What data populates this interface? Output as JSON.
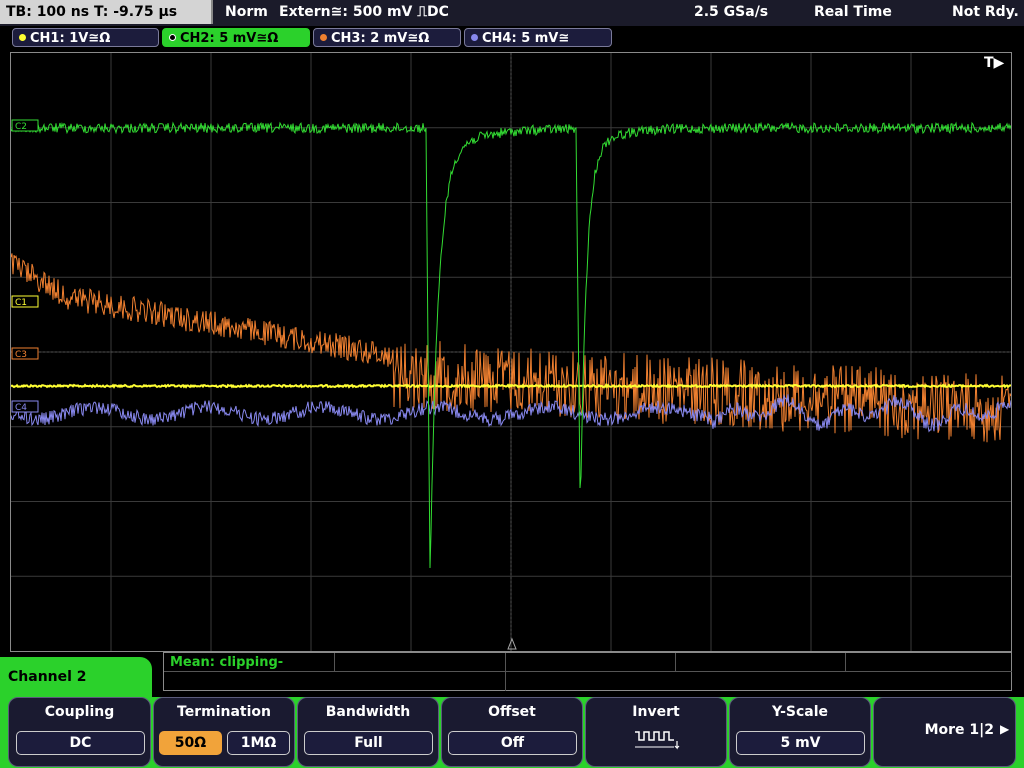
{
  "status": {
    "timebase": "TB: 100 ns   T: -9.75 µs",
    "mode": "Norm",
    "trigger": "Extern≅: 500 mV ⎍DC",
    "sample_rate": "2.5 GSa/s",
    "acq_mode": "Real Time",
    "state": "Not Rdy."
  },
  "channels": [
    {
      "label": "CH1: 1V≅Ω",
      "color": "#ffff33"
    },
    {
      "label": "CH2: 5 mV≅Ω",
      "color": "#33dd33",
      "active": true
    },
    {
      "label": "CH3: 2 mV≅Ω",
      "color": "#f08030"
    },
    {
      "label": "CH4: 5 mV≅",
      "color": "#8888ee"
    }
  ],
  "trigger_marker": "T▶",
  "markers": {
    "c1": "C1",
    "c3": "C3",
    "c4": "C4",
    "c2": "C2"
  },
  "measurement": {
    "mean": "Mean: clipping-"
  },
  "menu": {
    "title": "Channel 2",
    "coupling": {
      "title": "Coupling",
      "value": "DC"
    },
    "termination": {
      "title": "Termination",
      "opt1": "50Ω",
      "opt2": "1MΩ",
      "selected": "50Ω"
    },
    "bandwidth": {
      "title": "Bandwidth",
      "value": "Full"
    },
    "offset": {
      "title": "Offset",
      "value": "Off"
    },
    "invert": {
      "title": "Invert",
      "icon": "invert-waveform-icon"
    },
    "yscale": {
      "title": "Y-Scale",
      "value": "5 mV"
    },
    "more": {
      "label": "More 1|2"
    }
  },
  "colors": {
    "ch1": "#ffff33",
    "ch2": "#33dd33",
    "ch3": "#f08030",
    "ch4": "#8888ee",
    "accent": "#2bd12b"
  }
}
